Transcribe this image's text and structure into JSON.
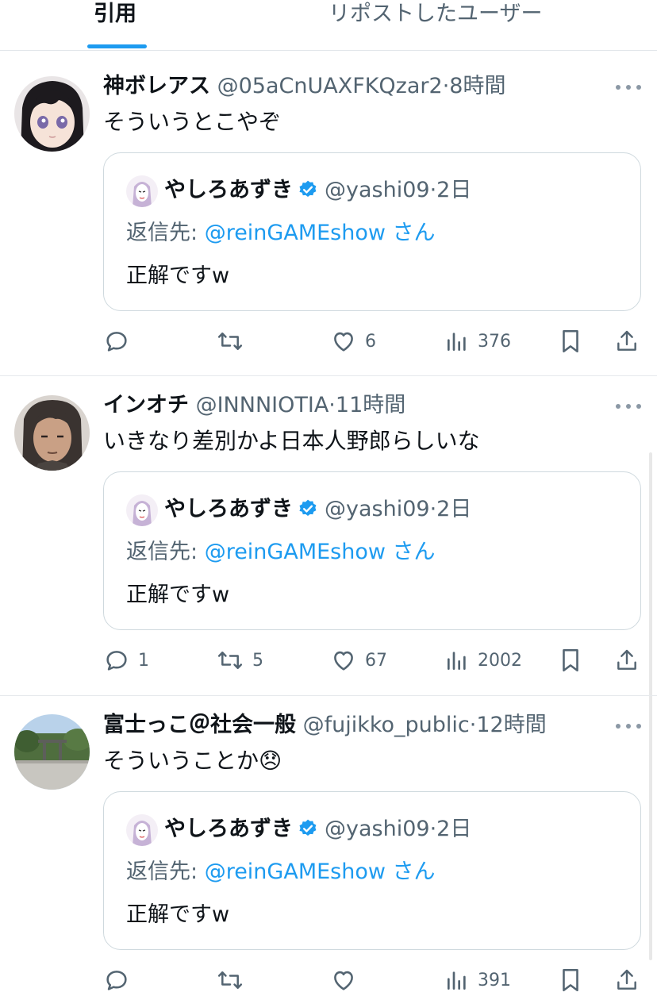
{
  "tabs": [
    {
      "label": "引用",
      "active": true
    },
    {
      "label": "リポストしたユーザー",
      "active": false
    }
  ],
  "accent_color": "#1d9bf0",
  "quoted": {
    "name": "やしろあずき",
    "handle": "@yashi09",
    "time": "2日",
    "reply_prefix": "返信先: ",
    "reply_mention": "@reinGAMEshow",
    "reply_suffix": " さん",
    "text": "正解ですw",
    "verified": true
  },
  "tweets": [
    {
      "name": "神ボレアス",
      "handle": "@05aCnUAXFKQzar2",
      "time": "8時間",
      "text": "そういうとこやぞ",
      "avatar": "anime-girl-avatar",
      "actions": {
        "replies": "",
        "reposts": "",
        "likes": "6",
        "views": "376"
      }
    },
    {
      "name": "インオチ",
      "handle": "@INNNIOTIA",
      "time": "11時間",
      "text": "いきなり差別かよ日本人野郎らしいな",
      "avatar": "anime-man-avatar",
      "actions": {
        "replies": "1",
        "reposts": "5",
        "likes": "67",
        "views": "2002"
      }
    },
    {
      "name": "富士っこ＠社会一般",
      "handle": "@fujikko_public",
      "time": "12時間",
      "text": "そういうことか",
      "emoji": "😞",
      "avatar": "shrine-photo-avatar",
      "actions": {
        "replies": "",
        "reposts": "",
        "likes": "",
        "views": "391"
      }
    }
  ]
}
